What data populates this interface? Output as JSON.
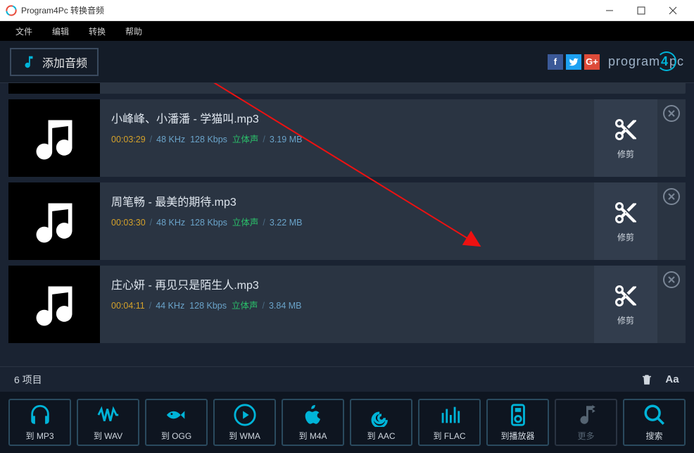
{
  "window": {
    "title": "Program4Pc 转换音频"
  },
  "menu": {
    "file": "文件",
    "edit": "编辑",
    "convert": "转换",
    "help": "帮助"
  },
  "header": {
    "add_audio": "添加音频",
    "brand_pre": "program",
    "brand_mid": "4",
    "brand_post": "pc"
  },
  "tracks": [
    {
      "title": "小峰峰、小潘潘 - 学猫叫.mp3",
      "duration": "00:03:29",
      "khz": "48 KHz",
      "kbps": "128 Kbps",
      "stereo": "立体声",
      "size": "3.19 MB",
      "trim": "修剪"
    },
    {
      "title": "周笔畅 - 最美的期待.mp3",
      "duration": "00:03:30",
      "khz": "48 KHz",
      "kbps": "128 Kbps",
      "stereo": "立体声",
      "size": "3.22 MB",
      "trim": "修剪"
    },
    {
      "title": "庄心妍 - 再见只是陌生人.mp3",
      "duration": "00:04:11",
      "khz": "44 KHz",
      "kbps": "128 Kbps",
      "stereo": "立体声",
      "size": "3.84 MB",
      "trim": "修剪"
    }
  ],
  "status": {
    "count": "6 项目"
  },
  "formats": {
    "mp3": "到 MP3",
    "wav": "到 WAV",
    "ogg": "到 OGG",
    "wma": "到 WMA",
    "m4a": "到 M4A",
    "aac": "到 AAC",
    "flac": "到 FLAC",
    "player": "到播放器",
    "more": "更多",
    "search": "搜索"
  }
}
